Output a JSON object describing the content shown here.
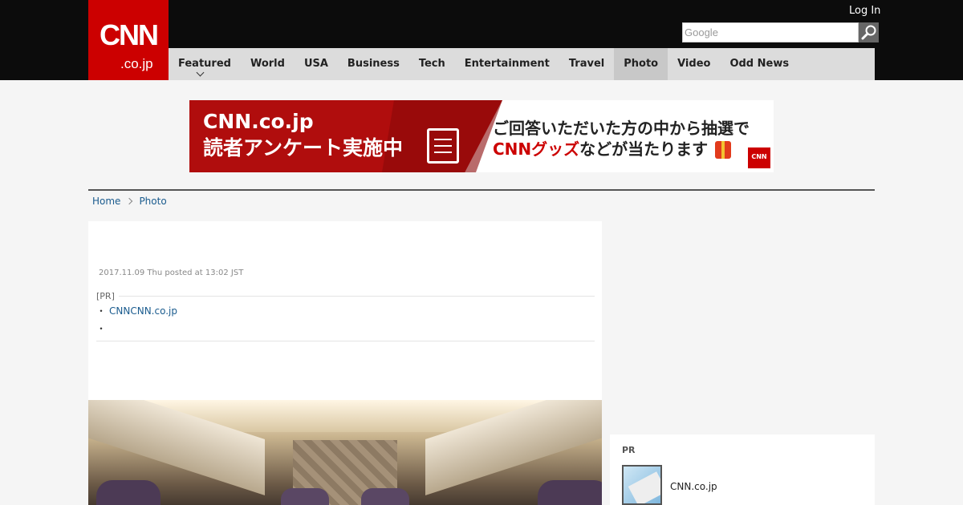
{
  "header": {
    "logo_text": "CNN",
    "logo_domain": ".co.jp",
    "login_label": "Log In",
    "search_placeholder": "Google",
    "nav": [
      {
        "label": "Featured"
      },
      {
        "label": "World"
      },
      {
        "label": "USA"
      },
      {
        "label": "Business"
      },
      {
        "label": "Tech"
      },
      {
        "label": "Entertainment"
      },
      {
        "label": "Travel"
      },
      {
        "label": "Photo",
        "active": true
      },
      {
        "label": "Video"
      },
      {
        "label": "Odd News"
      }
    ]
  },
  "banner": {
    "line1": "CNN.co.jp",
    "line2": "読者アンケート実施中",
    "line3": "ご回答いただいた方の中から抽選で",
    "line4_red": "CNNグッズ",
    "line4_rest": "などが当たります",
    "mini_logo": "CNN"
  },
  "breadcrumb": {
    "home": "Home",
    "current": "Photo"
  },
  "article": {
    "date": "2017.11.09 Thu posted at 13:02 JST",
    "pr_label": "[PR]",
    "pr_bullet": "・",
    "pr_link": "CNNCNN.co.jp",
    "pr_dot": "・"
  },
  "side_pr": {
    "title": "PR",
    "item_text": "CNN.co.jp"
  },
  "colors": {
    "brand_red": "#cc0000",
    "header_bg": "#0c0c0c",
    "nav_bg": "#dcdcdc",
    "link": "#1a5b8e"
  }
}
